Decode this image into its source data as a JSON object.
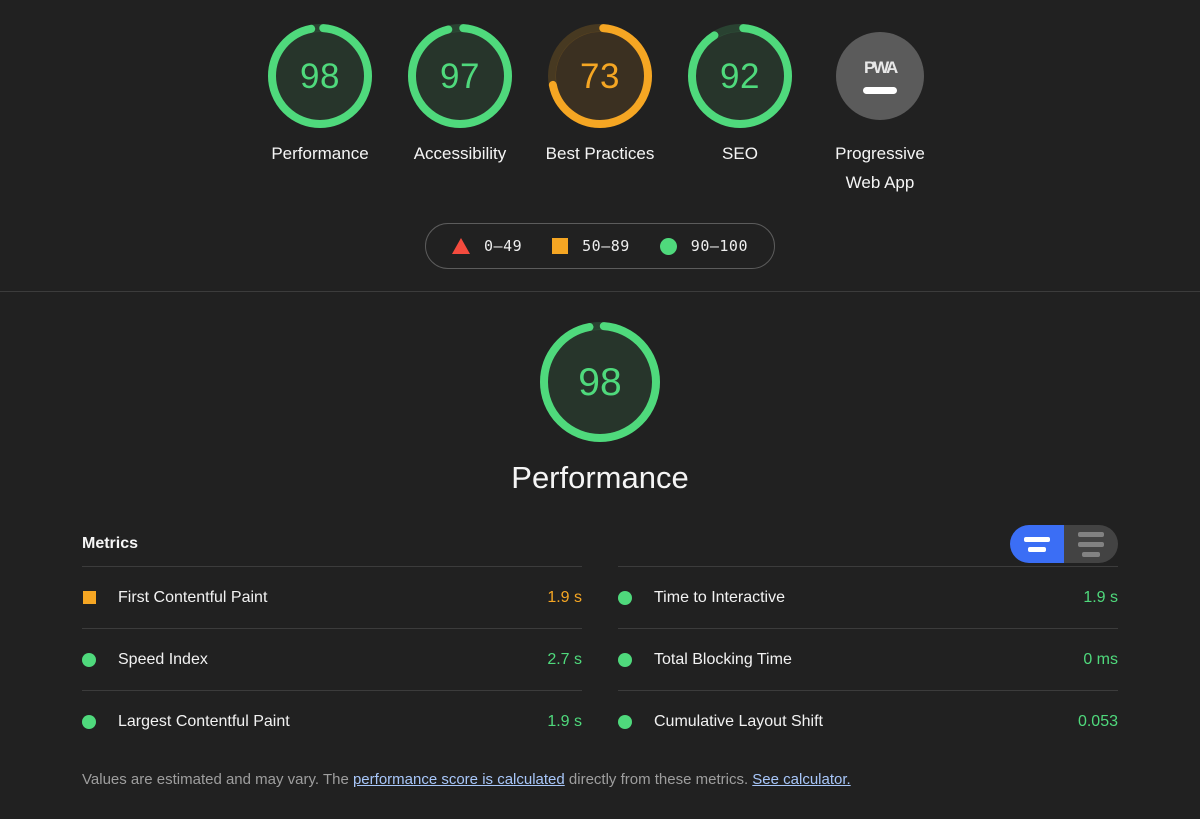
{
  "scores": {
    "gauges": [
      {
        "score": "98",
        "value": 98,
        "label": "Performance",
        "state": "pass"
      },
      {
        "score": "97",
        "value": 97,
        "label": "Accessibility",
        "state": "pass"
      },
      {
        "score": "73",
        "value": 73,
        "label": "Best Practices",
        "state": "average"
      },
      {
        "score": "92",
        "value": 92,
        "label": "SEO",
        "state": "pass"
      }
    ],
    "pwa": {
      "badge_text": "PWA",
      "label": "Progressive Web App",
      "icon": "pwa-dash-icon"
    }
  },
  "legend": {
    "items": [
      {
        "icon": "triangle-icon",
        "range": "0–49",
        "state": "fail"
      },
      {
        "icon": "square-icon",
        "range": "50–89",
        "state": "average"
      },
      {
        "icon": "circle-icon",
        "range": "90–100",
        "state": "pass"
      }
    ]
  },
  "category": {
    "score": "98",
    "value": 98,
    "title": "Performance",
    "state": "pass"
  },
  "metrics": {
    "title": "Metrics",
    "toggle": {
      "active_option": "simple-view",
      "inactive_option": "detail-view"
    },
    "columns": [
      {
        "rows": [
          {
            "marker": "square-icon",
            "state": "average",
            "name": "First Contentful Paint",
            "value": "1.9 s"
          },
          {
            "marker": "circle-icon",
            "state": "pass",
            "name": "Speed Index",
            "value": "2.7 s"
          },
          {
            "marker": "circle-icon",
            "state": "pass",
            "name": "Largest Contentful Paint",
            "value": "1.9 s"
          }
        ]
      },
      {
        "rows": [
          {
            "marker": "circle-icon",
            "state": "pass",
            "name": "Time to Interactive",
            "value": "1.9 s"
          },
          {
            "marker": "circle-icon",
            "state": "pass",
            "name": "Total Blocking Time",
            "value": "0 ms"
          },
          {
            "marker": "circle-icon",
            "state": "pass",
            "name": "Cumulative Layout Shift",
            "value": "0.053"
          }
        ]
      }
    ],
    "disclaimer": {
      "part1": "Values are estimated and may vary. The ",
      "link1": "performance score is calculated",
      "part2": " directly from these metrics. ",
      "link2": "See calculator."
    }
  },
  "colors": {
    "pass": "#4fd97c",
    "average": "#f5a623",
    "fail": "#f44b3e",
    "pass_bg": "#27352b",
    "average_bg": "#3b3021",
    "fail_bg": "#3a2726",
    "background": "#212121",
    "accent": "#3b6ef5",
    "link": "#a8c7fa"
  }
}
